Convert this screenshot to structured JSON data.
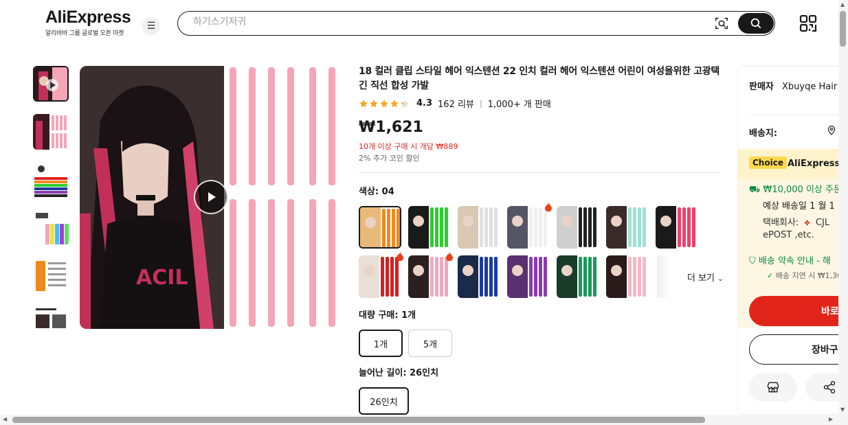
{
  "header": {
    "logo": "AliExpress",
    "tagline": "알리바바 그룹 글로벌 오픈 마켓",
    "search_placeholder": "하기스기저귀"
  },
  "product": {
    "title": "18 컬러 클립 스타일 헤어 익스텐션 22 인치 컬러 헤어 익스텐션 어린이 여성을위한 고광택 긴 직선 합성 가발",
    "rating": "4.3",
    "rating_value": 4.3,
    "reviews": "162 리뷰",
    "sold": "1,000+ 개 판매",
    "price": "₩1,621",
    "bulk_price": "10개 이상 구매 시 개당 ₩889",
    "coin_discount": "2% 추가 코인 할인",
    "color_label": "색상: 04",
    "more_label": "더 보기",
    "qty_label": "대량 구매: 1개",
    "qty_options": [
      "1개",
      "5개"
    ],
    "length_label": "늘어난 길이: 26인치",
    "length_options": [
      "26인치"
    ]
  },
  "swatches": [
    {
      "hair": "#e8b978",
      "strip": "#f08a1e",
      "fire": false
    },
    {
      "hair": "#1a1a1a",
      "strip": "#2ecc2e",
      "fire": false
    },
    {
      "hair": "#d8c8b4",
      "strip": "#e0e0e0",
      "fire": false
    },
    {
      "hair": "#555566",
      "strip": "#f0f0f0",
      "fire": true
    },
    {
      "hair": "#cfcfcf",
      "strip": "#222222",
      "fire": false
    },
    {
      "hair": "#3a2a2a",
      "strip": "#9fe0d8",
      "fire": false
    },
    {
      "hair": "#1a1a1a",
      "strip": "#f0406a",
      "fire": false
    },
    {
      "hair": "#e8e0d8",
      "strip": "#d42020",
      "fire": true
    },
    {
      "hair": "#2a2020",
      "strip": "#f0a8c0",
      "fire": true
    },
    {
      "hair": "#1a2a4a",
      "strip": "#1a3aa0",
      "fire": false
    },
    {
      "hair": "#5a3070",
      "strip": "#8a3ab0",
      "fire": false
    },
    {
      "hair": "#1a3a2a",
      "strip": "#1a9a5a",
      "fire": false
    },
    {
      "hair": "#2a1a1a",
      "strip": "#f4b8c8",
      "fire": false
    }
  ],
  "side_panel": {
    "seller_label": "판매자",
    "seller_name": "Xbuyqe Hair",
    "ship_label": "배송지:",
    "choice_badge": "Choice",
    "choice_name": "AliExpress",
    "free_ship": "₩10,000 이상 주문",
    "eta": "예상 배송일 1 월 1",
    "carrier": "택배회사:",
    "carrier_name": "CJL",
    "carrier2": "ePOST ,etc.",
    "promise": "배송 약속 안내 - 해",
    "delay": "배송 지연 시 ₩1,30",
    "buy_label": "바로",
    "cart_label": "장바구"
  },
  "colors": {
    "accent": "#e1251b",
    "choice": "#ffd84d",
    "green": "#0a8a3c",
    "pink_strip": "#f4a6b8"
  }
}
